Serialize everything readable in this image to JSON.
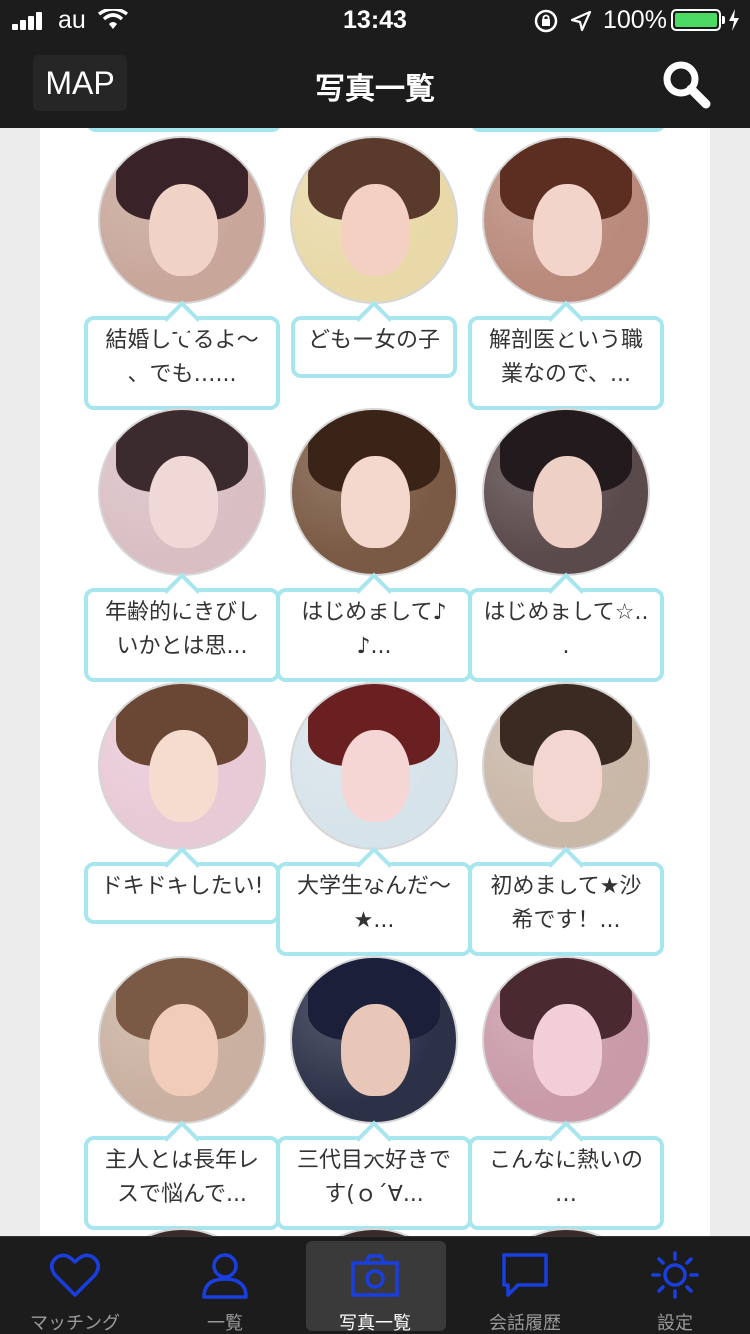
{
  "status_bar": {
    "carrier": "au",
    "time": "13:43",
    "battery_percent": "100%",
    "battery_level": 1.0
  },
  "nav": {
    "map_label": "MAP",
    "title": "写真一覧"
  },
  "profiles": [
    {
      "line1": "結婚してるよ〜",
      "line2": "、でも…...",
      "skin": "#f1d2c6",
      "hair": "#3a2328",
      "bg": "#c8a79a"
    },
    {
      "line1": "どもー女の子",
      "line2": "",
      "skin": "#f4d0c2",
      "hair": "#5a3a2c",
      "bg": "#e9d9a8"
    },
    {
      "line1": "解剖医という職",
      "line2": "業なので、...",
      "skin": "#f2d4cb",
      "hair": "#5c2e22",
      "bg": "#b98a7c"
    },
    {
      "line1": "年齢的にきびし",
      "line2": "いかとは思...",
      "skin": "#f0d8d6",
      "hair": "#3b2b2e",
      "bg": "#d9bfc4"
    },
    {
      "line1": "はじめまして♪",
      "line2": "♪...",
      "skin": "#f5d8cd",
      "hair": "#3a2418",
      "bg": "#7a5a44"
    },
    {
      "line1": "はじめまして☆..",
      "line2": ".",
      "skin": "#efd0c6",
      "hair": "#221a1c",
      "bg": "#5b4a4c"
    },
    {
      "line1": "ドキドキしたい!",
      "line2": "",
      "skin": "#f6dccf",
      "hair": "#6a4634",
      "bg": "#e8c9d6"
    },
    {
      "line1": "大学生なんだ〜",
      "line2": "★...",
      "skin": "#f6d6d4",
      "hair": "#6a2020",
      "bg": "#d7e3ea"
    },
    {
      "line1": "初めまして★沙",
      "line2": "希です！...",
      "skin": "#f4d6d0",
      "hair": "#3a2a22",
      "bg": "#c9b7a8"
    },
    {
      "line1": "主人とは長年レ",
      "line2": "スで悩んで...",
      "skin": "#f2ccbb",
      "hair": "#7a5a44",
      "bg": "#c9b0a0"
    },
    {
      "line1": "三代目大好きで",
      "line2": "す(ｏ´∀...",
      "skin": "#e9c7b8",
      "hair": "#1c1f3a",
      "bg": "#2c3148"
    },
    {
      "line1": "こんなに熱いの",
      "line2": "…",
      "skin": "#f2cfd8",
      "hair": "#4a2a30",
      "bg": "#c99aa8"
    }
  ],
  "tabs": [
    {
      "label": "マッチング",
      "icon": "heart-icon"
    },
    {
      "label": "一覧",
      "icon": "person-icon"
    },
    {
      "label": "写真一覧",
      "icon": "camera-icon",
      "active": true
    },
    {
      "label": "会話履歴",
      "icon": "chat-icon"
    },
    {
      "label": "設定",
      "icon": "sun-gear-icon"
    }
  ],
  "colors": {
    "bubble_border": "#a7e6ee",
    "tab_icon": "#1a3fe0",
    "bar_bg": "#1c1c1c"
  }
}
